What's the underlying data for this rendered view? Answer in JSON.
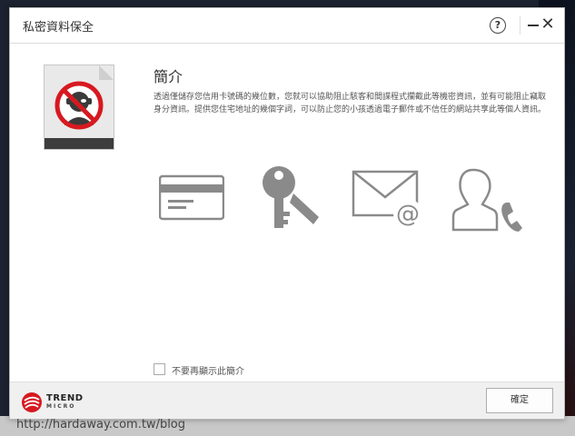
{
  "window": {
    "title": "私密資料保全",
    "help_label": "?",
    "close_label": "✕"
  },
  "intro": {
    "heading": "簡介",
    "description": "透過僅儲存您信用卡號碼的幾位數，您就可以協助阻止駭客和間諜程式攔截此等機密資訊，並有可能阻止竊取身分資訊。提供您住宅地址的幾個字詞，可以防止您的小孩透過電子郵件或不信任的網站共享此等個人資訊。"
  },
  "features": [
    {
      "icon": "credit-card-icon"
    },
    {
      "icon": "key-icon"
    },
    {
      "icon": "email-at-icon"
    },
    {
      "icon": "contact-phone-icon"
    }
  ],
  "hero_icon": "no-hacker-icon",
  "checkbox": {
    "label": "不要再顯示此簡介",
    "checked": false
  },
  "footer": {
    "logo_line1": "TREND",
    "logo_line2": "MICRO",
    "ok_label": "確定"
  },
  "watermark": "http://hardaway.com.tw/blog",
  "colors": {
    "brand_red": "#d71920",
    "icon_gray": "#8a8a8a"
  }
}
